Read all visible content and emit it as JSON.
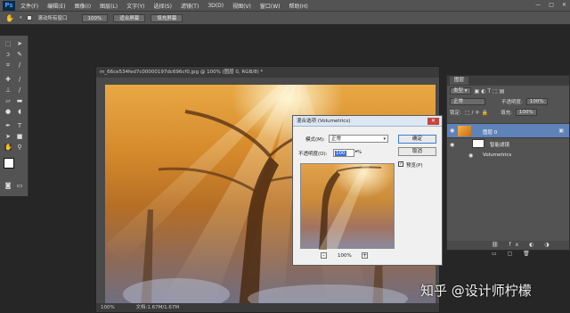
{
  "app": {
    "logo": "Ps"
  },
  "menubar": {
    "items": [
      "文件(F)",
      "编辑(E)",
      "图像(I)",
      "图层(L)",
      "文字(Y)",
      "选择(S)",
      "滤镜(T)",
      "3D(D)",
      "视图(V)",
      "窗口(W)",
      "帮助(H)"
    ],
    "window_controls": [
      "—",
      "□",
      "✕"
    ]
  },
  "options_bar": {
    "scroll_all_label": "滚动所有窗口",
    "btn_100": "100%",
    "btn_fit": "适合屏幕",
    "btn_fill": "填充屏幕"
  },
  "document": {
    "title": "m_66ce534fed7c00000197dc696cf0.jpg @ 100% (图层 0, RGB/8) *",
    "status_zoom": "100%",
    "status_doc": "文档:1.67M/1.67M"
  },
  "layers_panel": {
    "tab": "图层",
    "kind_label": "类型",
    "blend_mode": "正常",
    "opacity_label": "不透明度:",
    "opacity_value": "100%",
    "lock_label": "锁定:",
    "fill_label": "填充:",
    "fill_value": "100%",
    "layer0_name": "图层 0",
    "smart_filters_label": "智能滤镜",
    "filter_name": "Volumetrics"
  },
  "dialog": {
    "title": "混合选项 (Volumetrics)",
    "mode_label": "模式(M):",
    "mode_value": "正常",
    "opacity_label": "不透明度(O):",
    "opacity_value": "100",
    "opacity_unit": "%",
    "ok": "确定",
    "cancel": "取消",
    "preview_label": "预览(P)",
    "zoom_value": "100%"
  },
  "watermark": "知乎 @设计师柠檬"
}
